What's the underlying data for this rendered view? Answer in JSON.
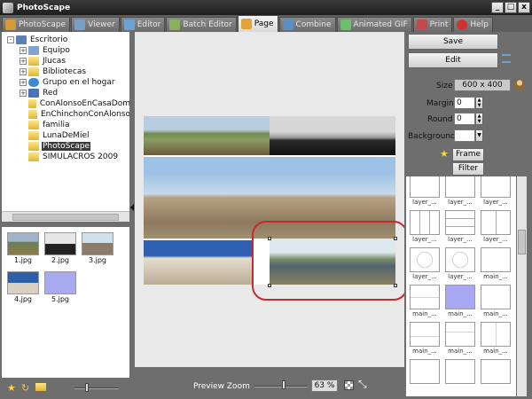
{
  "window": {
    "title": "PhotoScape",
    "min": "_",
    "max": "□",
    "close": "x"
  },
  "tabs": [
    {
      "label": "PhotoScape",
      "color": "#d49a3a"
    },
    {
      "label": "Viewer",
      "color": "#7aa0c8"
    },
    {
      "label": "Editor",
      "color": "#6aa3d6"
    },
    {
      "label": "Batch Editor",
      "color": "#89b15c"
    },
    {
      "label": "Page",
      "color": "#e0a43a"
    },
    {
      "label": "Combine",
      "color": "#5c8ec4"
    },
    {
      "label": "Animated GIF",
      "color": "#6cbf6c"
    },
    {
      "label": "Print",
      "color": "#c24a4a"
    },
    {
      "label": "Help",
      "color": "#cc3333"
    }
  ],
  "tree": [
    {
      "label": "Escritorio",
      "level": 0,
      "exp": "-",
      "icon": "#5b7fb6"
    },
    {
      "label": "Equipo",
      "level": 1,
      "exp": "+",
      "icon": "#7fa3cf"
    },
    {
      "label": "Jlucas",
      "level": 1,
      "exp": "+",
      "icon": "#e0b533"
    },
    {
      "label": "Bibliotecas",
      "level": 1,
      "exp": "+",
      "icon": "#e0b533"
    },
    {
      "label": "Grupo en el hogar",
      "level": 1,
      "exp": "+",
      "icon": "#3d8ad1"
    },
    {
      "label": "Red",
      "level": 1,
      "exp": "+",
      "icon": "#4a74b5"
    },
    {
      "label": "ConAlonsoEnCasaDom",
      "level": 1,
      "exp": "",
      "icon": "#e0b533"
    },
    {
      "label": "EnChinchonConAlonso",
      "level": 1,
      "exp": "",
      "icon": "#e0b533"
    },
    {
      "label": "familia",
      "level": 1,
      "exp": "",
      "icon": "#e0b533"
    },
    {
      "label": "LunaDeMiel",
      "level": 1,
      "exp": "",
      "icon": "#e0b533"
    },
    {
      "label": "PhotoScape",
      "level": 1,
      "exp": "",
      "icon": "#e0b533",
      "selected": true
    },
    {
      "label": "SIMULACROS 2009",
      "level": 1,
      "exp": "",
      "icon": "#e0b533"
    }
  ],
  "thumbnails": [
    {
      "label": "1.jpg"
    },
    {
      "label": "2.jpg"
    },
    {
      "label": "3.jpg"
    },
    {
      "label": "4.jpg"
    },
    {
      "label": "5.jpg"
    }
  ],
  "preview": {
    "zoom_label": "Preview Zoom",
    "zoom_value": "63 %"
  },
  "right": {
    "save": "Save",
    "edit": "Edit",
    "size_label": "Size",
    "size_value": "600 x 400",
    "margin_label": "Margin",
    "margin_value": "0",
    "round_label": "Round",
    "round_value": "0",
    "background_label": "Background",
    "frame": "Frame",
    "filter": "Filter"
  },
  "layouts": [
    "layer_...",
    "layer_...",
    "layer_...",
    "layer_...",
    "layer_...",
    "layer_...",
    "layer_...",
    "layer_...",
    "main_...",
    "main_...",
    "main_...",
    "main_...",
    "main_...",
    "main_...",
    "main_..."
  ]
}
